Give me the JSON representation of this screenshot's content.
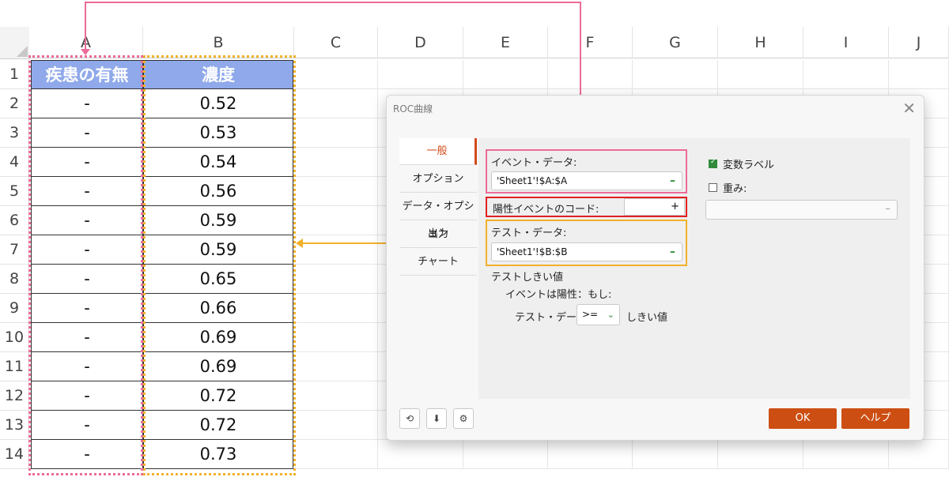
{
  "sheet": {
    "columns": [
      "A",
      "B",
      "C",
      "D",
      "E",
      "F",
      "G",
      "H",
      "I",
      "J"
    ],
    "rows": [
      "1",
      "2",
      "3",
      "4",
      "5",
      "6",
      "7",
      "8",
      "9",
      "10",
      "11",
      "12",
      "13",
      "14"
    ],
    "headers": {
      "a": "疾患の有無",
      "b": "濃度"
    },
    "col_a_values": [
      "-",
      "-",
      "-",
      "-",
      "-",
      "-",
      "-",
      "-",
      "-",
      "-",
      "-",
      "-",
      "-"
    ],
    "col_b_values": [
      "0.52",
      "0.53",
      "0.54",
      "0.56",
      "0.59",
      "0.59",
      "0.65",
      "0.66",
      "0.69",
      "0.69",
      "0.72",
      "0.72",
      "0.73"
    ]
  },
  "dialog": {
    "title": "ROC曲線",
    "close": "✕",
    "tabs": [
      "一般",
      "オプション",
      "データ・オプション",
      "出力",
      "チャート"
    ],
    "event_label": "イベント・データ:",
    "event_value": "'Sheet1'!$A:$A",
    "positive_label": "陽性イベントのコード:",
    "positive_plus": "+",
    "test_label": "テスト・データ:",
    "test_value": "'Sheet1'!$B:$B",
    "minus": "–",
    "threshold_title": "テストしきい値",
    "event_positive": "イベントは陽性：もし:",
    "test_data_text": "テスト・データ",
    "operator": ">=",
    "threshold_text": "しきい値",
    "var_label": "変数ラベル",
    "weight_label": "重み:",
    "ok": "OK",
    "help": "ヘルプ"
  }
}
